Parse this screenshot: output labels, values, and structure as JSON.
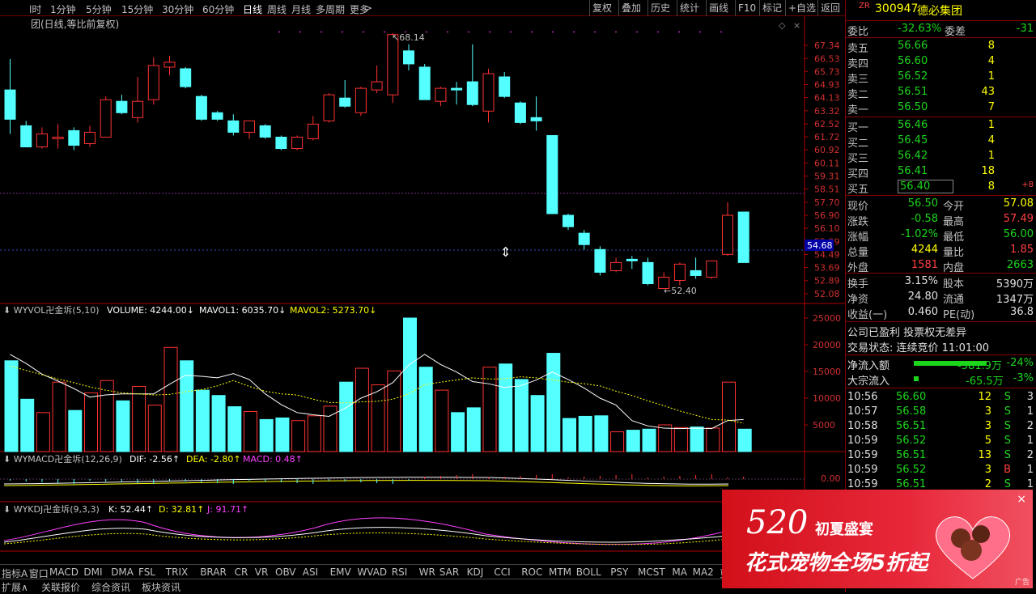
{
  "toolbar": {
    "periods": [
      "l时",
      "1分钟",
      "5分钟",
      "15分钟",
      "30分钟",
      "60分钟",
      "日线",
      "周线",
      "月线",
      "多周期",
      "更多"
    ],
    "active": "日线",
    "buttons": [
      "复权",
      "叠加",
      "历史",
      "统计",
      "画线",
      "F10",
      "标记",
      "+自选",
      "返回"
    ]
  },
  "chart_title": "团(日线,等比前复权)",
  "price_axis": [
    "67.34",
    "66.53",
    "65.73",
    "64.93",
    "64.13",
    "63.32",
    "62.52",
    "61.72",
    "60.92",
    "60.11",
    "59.31",
    "58.51",
    "57.70",
    "56.90",
    "56.10",
    "55.29",
    "54.49",
    "53.69",
    "52.89",
    "52.08"
  ],
  "current_price_tag": "54.68",
  "high_label": "68.14",
  "low_label": "52.40",
  "vol_header": {
    "name": "WYVOL卍金坼(5,10)",
    "volume": "VOLUME: 4244.00",
    "mavol1": "MAVOL1: 6035.70",
    "mavol2": "MAVOL2: 5273.70"
  },
  "vol_axis": [
    "25000",
    "20000",
    "15000",
    "10000",
    "5000"
  ],
  "macd_header": {
    "name": "WYMACD卍金坼(12,26,9)",
    "dif": "DIF: -2.56",
    "dea": "DEA: -2.80",
    "macd": "MACD: 0.48"
  },
  "macd_axis": "0.00",
  "kdj_header": {
    "name": "WYKDJ卍金坼(9,3,3)",
    "k": "K: 52.44",
    "d": "D: 32.81",
    "j": "J: 91.71"
  },
  "date_axis": {
    "left": "2021年",
    "m4": "4",
    "cursor": "2021/04/22/四",
    "m5": "5"
  },
  "bottom_tabs": [
    "指标A",
    "窗口",
    "MACD",
    "DMI",
    "DMA",
    "FSL",
    "TRIX",
    "BRAR",
    "CR",
    "VR",
    "OBV",
    "ASI",
    "EMV",
    "WVAD",
    "RSI",
    "WR",
    "SAR",
    "KDJ",
    "CCI",
    "ROC",
    "MTM",
    "BOLL",
    "PSY",
    "MCST",
    "MA",
    "MA2",
    "更多",
    "设"
  ],
  "bottom_tabs2": [
    "扩展∧",
    "关联报价",
    "综合资讯",
    "板块资讯"
  ],
  "chart_data": {
    "type": "candlestick",
    "title": "团(日线,等比前复权)",
    "candles": [
      {
        "o": 64.6,
        "c": 62.8,
        "h": 66.5,
        "l": 61.9
      },
      {
        "o": 62.4,
        "c": 61.1,
        "h": 62.7,
        "l": 61.1
      },
      {
        "o": 61.1,
        "c": 61.9,
        "h": 62.3,
        "l": 61.0
      },
      {
        "o": 61.6,
        "c": 61.7,
        "h": 62.5,
        "l": 61.0
      },
      {
        "o": 62.1,
        "c": 61.2,
        "h": 62.3,
        "l": 60.9
      },
      {
        "o": 61.3,
        "c": 62.0,
        "h": 62.4,
        "l": 61.1
      },
      {
        "o": 61.7,
        "c": 64.0,
        "h": 64.2,
        "l": 61.7
      },
      {
        "o": 63.9,
        "c": 63.2,
        "h": 64.3,
        "l": 63.1
      },
      {
        "o": 62.9,
        "c": 63.9,
        "h": 65.4,
        "l": 62.6
      },
      {
        "o": 64.0,
        "c": 66.1,
        "h": 66.6,
        "l": 63.7
      },
      {
        "o": 66.0,
        "c": 66.3,
        "h": 66.7,
        "l": 65.5
      },
      {
        "o": 65.9,
        "c": 64.8,
        "h": 66.0,
        "l": 64.7
      },
      {
        "o": 64.2,
        "c": 62.8,
        "h": 64.3,
        "l": 62.7
      },
      {
        "o": 63.2,
        "c": 62.8,
        "h": 63.3,
        "l": 62.7
      },
      {
        "o": 62.7,
        "c": 62.0,
        "h": 63.1,
        "l": 61.8
      },
      {
        "o": 62.0,
        "c": 62.7,
        "h": 62.7,
        "l": 61.6
      },
      {
        "o": 62.4,
        "c": 61.7,
        "h": 62.5,
        "l": 61.6
      },
      {
        "o": 61.7,
        "c": 61.0,
        "h": 61.8,
        "l": 60.9
      },
      {
        "o": 61.0,
        "c": 61.7,
        "h": 61.8,
        "l": 60.9
      },
      {
        "o": 61.6,
        "c": 62.5,
        "h": 63.0,
        "l": 61.5
      },
      {
        "o": 62.7,
        "c": 64.3,
        "h": 64.4,
        "l": 62.6
      },
      {
        "o": 64.1,
        "c": 63.6,
        "h": 65.2,
        "l": 63.5
      },
      {
        "o": 63.2,
        "c": 64.7,
        "h": 64.8,
        "l": 63.0
      },
      {
        "o": 64.6,
        "c": 65.1,
        "h": 66.1,
        "l": 64.4
      },
      {
        "o": 64.3,
        "c": 68.0,
        "h": 68.1,
        "l": 63.8
      },
      {
        "o": 67.0,
        "c": 66.2,
        "h": 67.4,
        "l": 65.8
      },
      {
        "o": 66.0,
        "c": 64.0,
        "h": 66.2,
        "l": 64.0
      },
      {
        "o": 63.9,
        "c": 64.7,
        "h": 64.8,
        "l": 63.6
      },
      {
        "o": 64.7,
        "c": 64.6,
        "h": 65.1,
        "l": 63.7
      },
      {
        "o": 65.1,
        "c": 63.7,
        "h": 67.4,
        "l": 63.6
      },
      {
        "o": 63.3,
        "c": 65.6,
        "h": 65.9,
        "l": 62.6
      },
      {
        "o": 65.4,
        "c": 64.2,
        "h": 65.7,
        "l": 64.1
      },
      {
        "o": 63.8,
        "c": 62.6,
        "h": 63.9,
        "l": 62.5
      },
      {
        "o": 62.9,
        "c": 62.7,
        "h": 64.2,
        "l": 62.1
      },
      {
        "o": 61.8,
        "c": 57.0,
        "h": 61.8,
        "l": 57.0
      },
      {
        "o": 56.9,
        "c": 56.2,
        "h": 57.0,
        "l": 56.0
      },
      {
        "o": 55.8,
        "c": 55.1,
        "h": 56.0,
        "l": 54.8
      },
      {
        "o": 54.8,
        "c": 53.4,
        "h": 55.0,
        "l": 53.2
      },
      {
        "o": 53.5,
        "c": 54.0,
        "h": 54.3,
        "l": 53.4
      },
      {
        "o": 54.2,
        "c": 54.1,
        "h": 54.4,
        "l": 53.6
      },
      {
        "o": 54.0,
        "c": 52.7,
        "h": 54.3,
        "l": 52.6
      },
      {
        "o": 52.4,
        "c": 53.1,
        "h": 53.4,
        "l": 52.4
      },
      {
        "o": 52.9,
        "c": 53.9,
        "h": 54.0,
        "l": 52.6
      },
      {
        "o": 53.5,
        "c": 53.2,
        "h": 54.3,
        "l": 53.0
      },
      {
        "o": 53.1,
        "c": 54.1,
        "h": 54.1,
        "l": 53.0
      },
      {
        "o": 54.5,
        "c": 56.9,
        "h": 57.7,
        "l": 54.4
      },
      {
        "o": 57.1,
        "c": 54.0,
        "h": 57.1,
        "l": 54.0
      }
    ],
    "volumes": [
      17000,
      9800,
      7300,
      13000,
      7700,
      11000,
      13300,
      9500,
      12200,
      8700,
      19500,
      17000,
      11500,
      10500,
      8400,
      7500,
      6000,
      6300,
      5800,
      6700,
      8500,
      13000,
      15600,
      12500,
      15100,
      25000,
      15800,
      11500,
      7300,
      8200,
      15800,
      16400,
      13500,
      10500,
      18400,
      6200,
      6600,
      6700,
      3700,
      4000,
      4200,
      5000,
      4500,
      4600,
      4400,
      13000,
      4200
    ],
    "mavol1": [
      18200,
      16500,
      14500,
      13200,
      11800,
      10200,
      10600,
      10800,
      10800,
      10800,
      12600,
      14300,
      14100,
      13800,
      14600,
      13500,
      10800,
      8800,
      7300,
      6900,
      6600,
      8100,
      10000,
      11200,
      12900,
      16200,
      18200,
      16300,
      14900,
      13100,
      12700,
      12000,
      12300,
      13400,
      14900,
      13500,
      11900,
      10000,
      8700,
      5800,
      4800,
      4400,
      4300,
      4400,
      4300,
      5800,
      6000
    ],
    "mavol2": [
      16000,
      15200,
      14400,
      13600,
      12900,
      12100,
      11500,
      11000,
      10800,
      10600,
      10700,
      11200,
      11600,
      12300,
      13300,
      12200,
      11300,
      10800,
      10600,
      9800,
      9200,
      9100,
      9300,
      9400,
      9800,
      10800,
      12500,
      13000,
      13400,
      13800,
      13600,
      13600,
      14000,
      13800,
      13400,
      13000,
      12700,
      12300,
      11300,
      10500,
      9500,
      8600,
      7600,
      6800,
      6000,
      5900,
      5300
    ],
    "vol_ylim": [
      0,
      25000
    ],
    "price_ylim": [
      52.08,
      67.34
    ]
  },
  "right_panel": {
    "code": "300947",
    "name": "德必集团",
    "tag": "ZR",
    "weibi_label": "委比",
    "weibi": "-32.63%",
    "weicha_label": "委差",
    "weicha": "-31",
    "sells": [
      {
        "label": "卖五",
        "price": "56.66",
        "vol": "8"
      },
      {
        "label": "卖四",
        "price": "56.60",
        "vol": "4"
      },
      {
        "label": "卖三",
        "price": "56.52",
        "vol": "1"
      },
      {
        "label": "卖二",
        "price": "56.51",
        "vol": "43"
      },
      {
        "label": "卖一",
        "price": "56.50",
        "vol": "7"
      }
    ],
    "buys": [
      {
        "label": "买一",
        "price": "56.46",
        "vol": "1",
        "delta": ""
      },
      {
        "label": "买二",
        "price": "56.45",
        "vol": "4",
        "delta": ""
      },
      {
        "label": "买三",
        "price": "56.42",
        "vol": "1",
        "delta": ""
      },
      {
        "label": "买四",
        "price": "56.41",
        "vol": "18",
        "delta": ""
      },
      {
        "label": "买五",
        "price": "56.40",
        "vol": "8",
        "delta": "+8"
      }
    ],
    "stats": [
      {
        "l1": "现价",
        "v1": "56.50",
        "l2": "今开",
        "v2": "57.08"
      },
      {
        "l1": "涨跌",
        "v1": "-0.58",
        "l2": "最高",
        "v2": "57.49"
      },
      {
        "l1": "涨幅",
        "v1": "-1.02%",
        "l2": "最低",
        "v2": "56.00"
      },
      {
        "l1": "总量",
        "v1": "4244",
        "l2": "量比",
        "v2": "1.85"
      },
      {
        "l1": "外盘",
        "v1": "1581",
        "l2": "内盘",
        "v2": "2663"
      }
    ],
    "stats2": [
      {
        "l1": "换手",
        "v1": "3.15%",
        "l2": "股本",
        "v2": "5390万"
      },
      {
        "l1": "净资",
        "v1": "24.80",
        "l2": "流通",
        "v2": "1347万"
      },
      {
        "l1": "收益(一)",
        "v1": "0.460",
        "l2": "PE(动)",
        "v2": "36.8"
      }
    ],
    "company_status": "公司已盈利 投票权无差异",
    "trade_status": "交易状态: 连续竞价 11:01:00",
    "net_inflow_label": "净流入额",
    "net_inflow": "-581.9万",
    "net_inflow_pct": "-24%",
    "big_inflow_label": "大宗流入",
    "big_inflow": "-65.5万",
    "big_inflow_pct": "-3%",
    "ticks": [
      {
        "t": "10:56",
        "p": "56.60",
        "v": "12",
        "s": "S",
        "n": "3"
      },
      {
        "t": "10:57",
        "p": "56.58",
        "v": "3",
        "s": "S",
        "n": "1"
      },
      {
        "t": "10:58",
        "p": "56.51",
        "v": "3",
        "s": "S",
        "n": "2"
      },
      {
        "t": "10:59",
        "p": "56.52",
        "v": "5",
        "s": "S",
        "n": "1"
      },
      {
        "t": "10:59",
        "p": "56.51",
        "v": "13",
        "s": "S",
        "n": "2"
      },
      {
        "t": "10:59",
        "p": "56.52",
        "v": "3",
        "s": "B",
        "n": "1"
      },
      {
        "t": "10:59",
        "p": "56.51",
        "v": "2",
        "s": "S",
        "n": "1"
      }
    ]
  },
  "ad": {
    "num": "520",
    "sub": "初夏盛宴",
    "main": "花式宠物全场5折起",
    "tag": "广告",
    "close": "×"
  }
}
